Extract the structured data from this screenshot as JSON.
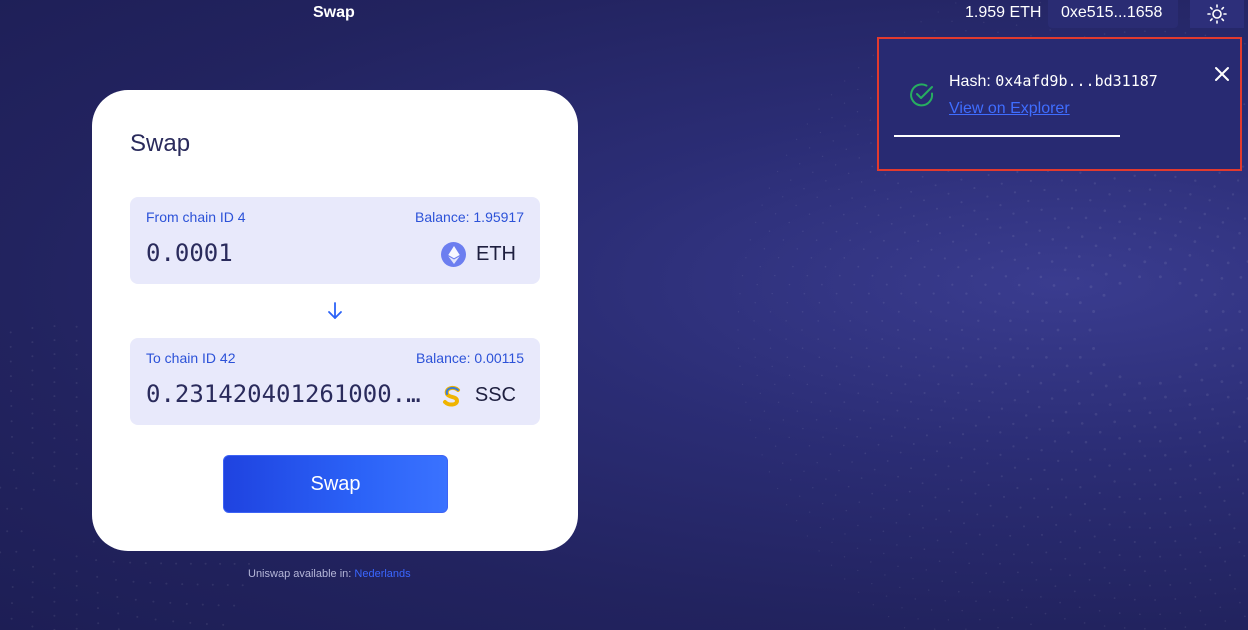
{
  "topbar": {
    "title": "Swap",
    "eth_balance": "1.959 ETH",
    "account": "0xe515...1658",
    "theme_icon": "sun-icon"
  },
  "card": {
    "title": "Swap",
    "from": {
      "label": "From chain ID 4",
      "balance": "Balance: 1.95917",
      "amount": "0.0001",
      "token": "ETH",
      "token_icon": "ethereum-icon"
    },
    "arrow_icon": "arrow-down-icon",
    "to": {
      "label": "To chain ID 42",
      "balance": "Balance: 0.00115",
      "amount": "0.231420401261000...",
      "token": "SSC",
      "token_icon": "ssc-token-icon"
    },
    "swap_button": "Swap"
  },
  "footer": {
    "text": "Uniswap available in: ",
    "language": "Nederlands"
  },
  "toast": {
    "hash_label": "Hash: ",
    "hash_value": "0x4afd9b...bd31187",
    "link": "View on Explorer",
    "progress": 0.62
  },
  "colors": {
    "accent": "#2b62f7",
    "success": "#27ae60",
    "highlight_border": "#e23a2e"
  }
}
